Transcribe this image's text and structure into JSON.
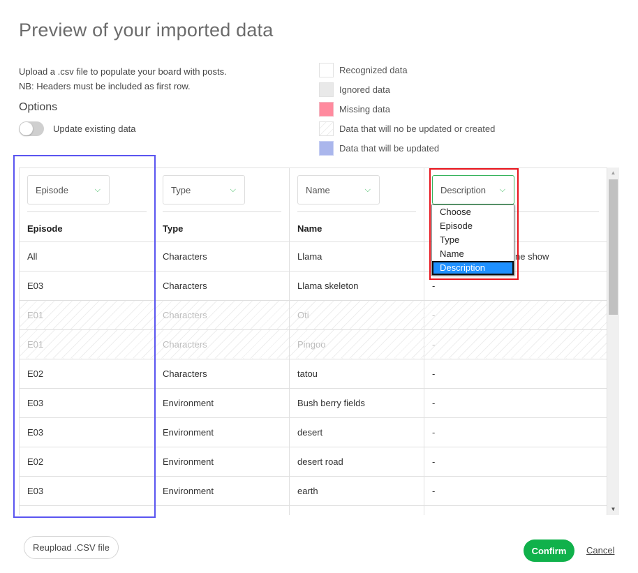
{
  "title": "Preview of your imported data",
  "intro": {
    "line1": "Upload a .csv file to populate your board with posts.",
    "line2": "NB: Headers must be included as first row."
  },
  "options": {
    "title": "Options",
    "toggle_label": "Update existing data",
    "toggle_on": false
  },
  "legend": [
    {
      "label": "Recognized data",
      "color": "#ffffff"
    },
    {
      "label": "Ignored data",
      "color": "#e9e9e9"
    },
    {
      "label": "Missing data",
      "color": "#ff8a9e"
    },
    {
      "label": "Data that will no be updated or created",
      "color": "hatched"
    },
    {
      "label": "Data that will be updated",
      "color": "#aab6ec"
    }
  ],
  "table": {
    "selectors": [
      "Episode",
      "Type",
      "Name",
      "Description"
    ],
    "headers": [
      "Episode",
      "Type",
      "Name",
      ""
    ],
    "rows": [
      {
        "cells": [
          "All",
          "Characters",
          "Llama",
          "ne show"
        ],
        "hatched": false
      },
      {
        "cells": [
          "E03",
          "Characters",
          "Llama skeleton",
          "-"
        ],
        "hatched": false
      },
      {
        "cells": [
          "E01",
          "Characters",
          "Oti",
          "-"
        ],
        "hatched": true
      },
      {
        "cells": [
          "E01",
          "Characters",
          "Pingoo",
          "-"
        ],
        "hatched": true
      },
      {
        "cells": [
          "E02",
          "Characters",
          "tatou",
          "-"
        ],
        "hatched": false
      },
      {
        "cells": [
          "E03",
          "Environment",
          "Bush berry fields",
          "-"
        ],
        "hatched": false
      },
      {
        "cells": [
          "E03",
          "Environment",
          "desert",
          "-"
        ],
        "hatched": false
      },
      {
        "cells": [
          "E02",
          "Environment",
          "desert road",
          "-"
        ],
        "hatched": false
      },
      {
        "cells": [
          "E03",
          "Environment",
          "earth",
          "-"
        ],
        "hatched": false
      },
      {
        "cells": [
          "",
          "",
          "",
          ""
        ],
        "hatched": false
      }
    ]
  },
  "dropdown": {
    "options": [
      "Choose",
      "Episode",
      "Type",
      "Name",
      "Description"
    ],
    "selected": "Description"
  },
  "icons": {
    "chevron": "⌵",
    "scroll_up": "▲",
    "scroll_down": "▼"
  },
  "footer": {
    "reupload_label": "Reupload .CSV file",
    "confirm_label": "Confirm",
    "cancel_label": "Cancel"
  },
  "colors": {
    "accent_green": "#10b14b",
    "column_highlight": "#5a55f0",
    "dropdown_highlight": "#e8141c",
    "selected_option": "#1e90ff"
  }
}
